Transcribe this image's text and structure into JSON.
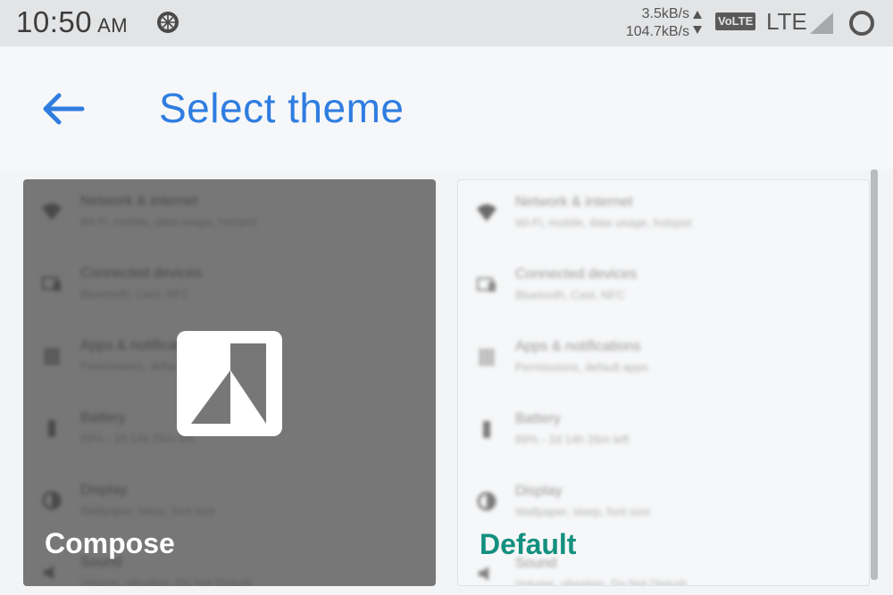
{
  "status_bar": {
    "time": "10:50",
    "ampm": "AM",
    "net_up": "3.5kB/s",
    "net_down": "104.7kB/s",
    "volte": "VoLTE",
    "network": "LTE",
    "icons": [
      "lemon-icon",
      "net-arrows-icon",
      "signal-icon",
      "battery-icon"
    ]
  },
  "app_bar": {
    "back_icon": "arrow-left-icon",
    "title": "Select theme",
    "title_color": "#2f7de1"
  },
  "themes": [
    {
      "label": "Compose",
      "label_color": "#ffffff",
      "card_color": "#777777",
      "badge_icon": "compose-logo-icon",
      "settings": [
        {
          "icon": "wifi-icon",
          "title": "Network & internet",
          "subtitle": "Wi-Fi, mobile, data usage, hotspot"
        },
        {
          "icon": "devices-icon",
          "title": "Connected devices",
          "subtitle": "Bluetooth, Cast, NFC"
        },
        {
          "icon": "apps-icon",
          "title": "Apps & notifications",
          "subtitle": "Permissions, default apps"
        },
        {
          "icon": "battery-icon",
          "title": "Battery",
          "subtitle": "89% - 2d 14h 26m left"
        },
        {
          "icon": "display-icon",
          "title": "Display",
          "subtitle": "Wallpaper, sleep, font size"
        },
        {
          "icon": "sound-icon",
          "title": "Sound",
          "subtitle": "Volume, vibration, Do Not Disturb"
        }
      ]
    },
    {
      "label": "Default",
      "label_color": "#13907f",
      "card_color": "#f6f7f8",
      "settings": [
        {
          "icon": "wifi-icon",
          "title": "Network & internet",
          "subtitle": "Wi-Fi, mobile, data usage, hotspot"
        },
        {
          "icon": "devices-icon",
          "title": "Connected devices",
          "subtitle": "Bluetooth, Cast, NFC"
        },
        {
          "icon": "apps-icon",
          "title": "Apps & notifications",
          "subtitle": "Permissions, default apps"
        },
        {
          "icon": "battery-icon",
          "title": "Battery",
          "subtitle": "89% - 2d 14h 26m left"
        },
        {
          "icon": "display-icon",
          "title": "Display",
          "subtitle": "Wallpaper, sleep, font size"
        },
        {
          "icon": "sound-icon",
          "title": "Sound",
          "subtitle": "Volume, vibration, Do Not Disturb"
        }
      ]
    }
  ]
}
